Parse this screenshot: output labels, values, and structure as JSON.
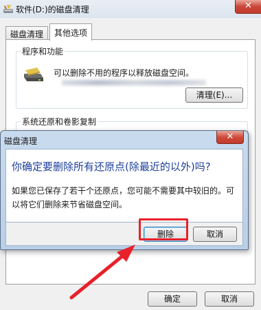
{
  "window": {
    "title": "软件(D:)的磁盘清理",
    "close_glyph": "✕"
  },
  "tabs": [
    {
      "label": "磁盘清理"
    },
    {
      "label": "其他选项"
    }
  ],
  "groups": {
    "programs": {
      "legend": "程序和功能",
      "description": "可以删除不用的程序以释放磁盘空间。",
      "button_label": "清理(E)..."
    },
    "restore": {
      "legend": "系统还原和卷影复制"
    }
  },
  "footer": {
    "ok_label": "确定",
    "cancel_label": "取消"
  },
  "dialog": {
    "title": "磁盘清理",
    "close_glyph": "✕",
    "heading": "你确定要删除所有还原点(除最近的以外)吗?",
    "message": "如果您已保存了若干个还原点，您可能不需要其中较旧的。可以将它们删除来节省磁盘空间。",
    "delete_label": "删除",
    "cancel_label": "取消"
  },
  "colors": {
    "highlight": "#e8202a",
    "heading_blue": "#1e3f9b"
  },
  "icons": {
    "window_icon": "disk-cleanup-icon",
    "program_icon": "drive-icon"
  }
}
